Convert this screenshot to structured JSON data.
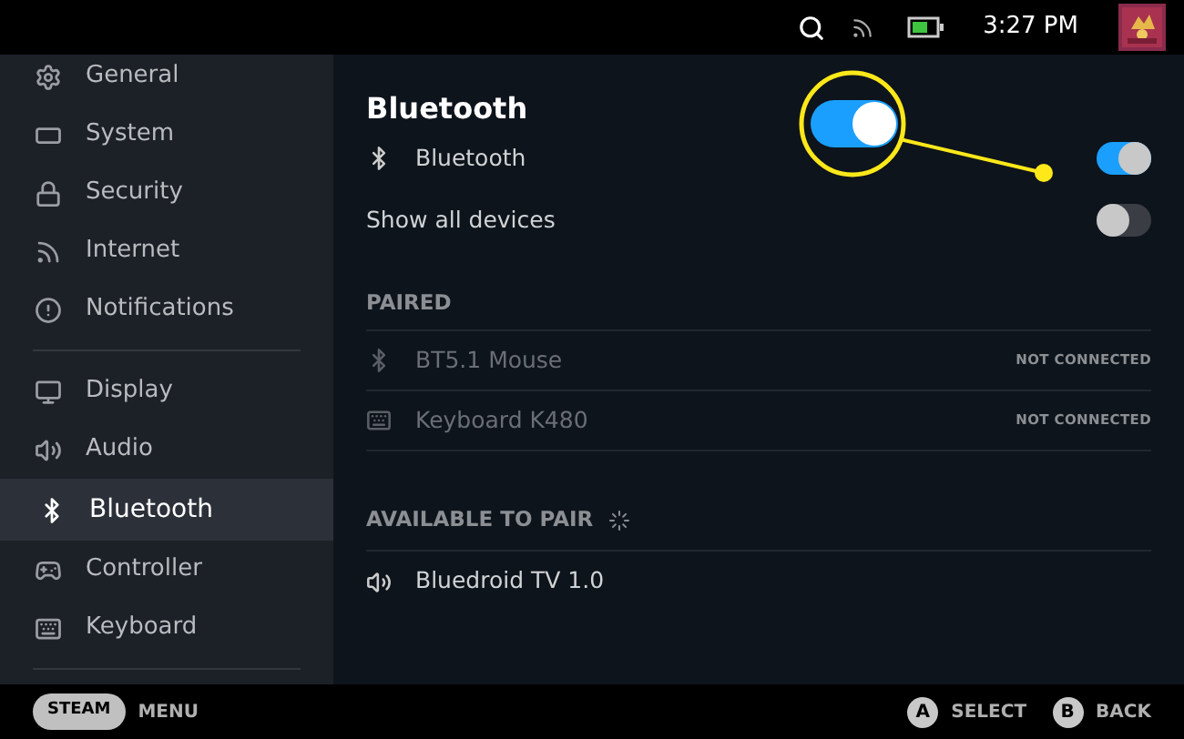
{
  "top_bar": {
    "time": "3:27 PM"
  },
  "sidebar": {
    "groups": [
      {
        "items": [
          {
            "label": "General",
            "kind": "gear",
            "selected": false
          },
          {
            "label": "System",
            "kind": "system",
            "selected": false
          },
          {
            "label": "Security",
            "kind": "lock",
            "selected": false
          },
          {
            "label": "Internet",
            "kind": "signal",
            "selected": false
          },
          {
            "label": "Notifications",
            "kind": "alert",
            "selected": false
          }
        ]
      },
      {
        "items": [
          {
            "label": "Display",
            "kind": "monitor",
            "selected": false
          },
          {
            "label": "Audio",
            "kind": "speaker",
            "selected": false
          },
          {
            "label": "Bluetooth",
            "kind": "bluetooth",
            "selected": true
          },
          {
            "label": "Controller",
            "kind": "gamepad",
            "selected": false
          },
          {
            "label": "Keyboard",
            "kind": "keyboard",
            "selected": false
          }
        ]
      }
    ]
  },
  "content": {
    "title": "Bluetooth",
    "settings": [
      {
        "label": "Bluetooth",
        "kind": "bluetooth",
        "on": true,
        "highlighted": true
      },
      {
        "label": "Show all devices",
        "on": false,
        "highlighted": false
      }
    ],
    "paired": {
      "heading": "PAIRED",
      "devices": [
        {
          "name": "BT5.1 Mouse",
          "kind": "bluetooth",
          "status": "NOT CONNECTED"
        },
        {
          "name": "Keyboard K480",
          "kind": "keyboard",
          "status": "NOT CONNECTED"
        }
      ]
    },
    "available": {
      "heading": "AVAILABLE TO PAIR",
      "searching": true,
      "devices": [
        {
          "name": "Bluedroid TV 1.0",
          "kind": "speaker"
        }
      ]
    }
  },
  "footer": {
    "left": [
      {
        "key": "STEAM",
        "label": "MENU"
      }
    ],
    "right": [
      {
        "key": "A",
        "label": "SELECT"
      },
      {
        "key": "B",
        "label": "BACK"
      }
    ]
  }
}
